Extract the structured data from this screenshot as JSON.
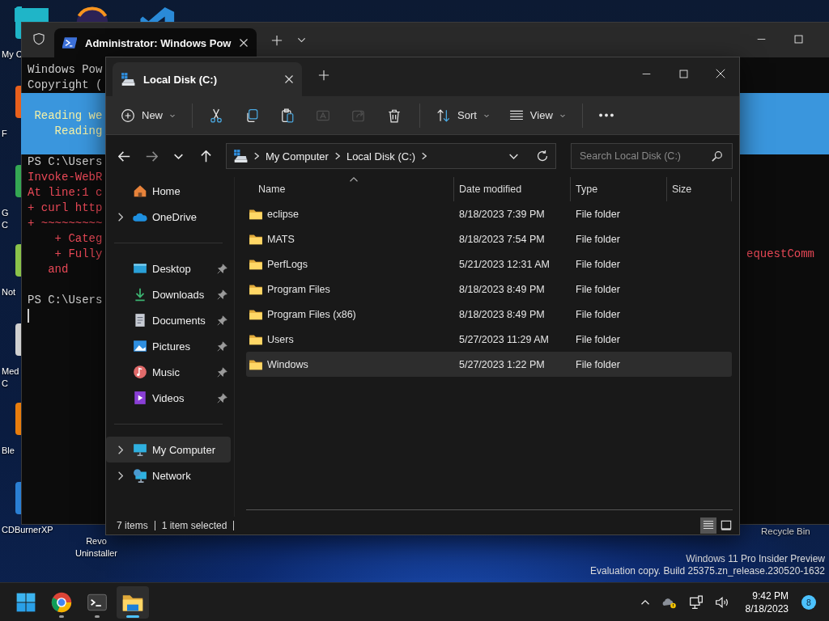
{
  "desktop": {
    "icons": [
      {
        "lines": [
          "My C"
        ],
        "color": "#1fb5c8"
      },
      {
        "lines": [
          "F"
        ],
        "color": "#e8601c"
      },
      {
        "lines": [
          "G",
          "C"
        ],
        "color": "#34a853"
      },
      {
        "lines": [
          "Not"
        ],
        "color": "#8bc34a"
      },
      {
        "lines": [
          "Med",
          "C"
        ],
        "color": "#d0d0d0"
      },
      {
        "lines": [
          "Ble"
        ],
        "color": "#e87d0d"
      },
      {
        "lines": [
          "CDBurnerXP"
        ],
        "color": "#2a7fd4"
      }
    ],
    "uninstaller_label": [
      "Revo",
      "Uninstaller"
    ],
    "recycle_bin_label": "Recycle Bin",
    "watermark": [
      "Windows 11 Pro Insider Preview",
      "Evaluation copy. Build 25375.zn_release.230520-1632"
    ]
  },
  "terminal_window": {
    "tab_title": "Administrator: Windows Pow",
    "lines": [
      {
        "text": "Windows Pow",
        "kind": "normal"
      },
      {
        "text": "Copyright (",
        "kind": "normal"
      },
      {
        "kind": "banner"
      },
      {
        "text": " Reading we",
        "kind": "banner"
      },
      {
        "text": "    Reading",
        "kind": "banner"
      },
      {
        "kind": "banner"
      },
      {
        "text": "PS C:\\Users",
        "kind": "normal"
      },
      {
        "text": "Invoke-WebR",
        "kind": "error"
      },
      {
        "text": "At line:1 c",
        "kind": "error"
      },
      {
        "text": "+ curl http",
        "kind": "error"
      },
      {
        "text": "+ ~~~~~~~~~",
        "kind": "error"
      },
      {
        "text": "    + Categ",
        "kind": "error"
      },
      {
        "text": "    + Fully",
        "kind": "error",
        "tail": "equestComm"
      },
      {
        "text": "   and",
        "kind": "error"
      },
      {
        "kind": "normal"
      },
      {
        "text": "PS C:\\Users",
        "kind": "normal"
      }
    ]
  },
  "explorer_window": {
    "tab_title": "Local Disk (C:)",
    "toolbar": [
      {
        "kind": "new",
        "label": "New",
        "disabled": false
      },
      {
        "kind": "separator"
      },
      {
        "kind": "cut",
        "disabled": false
      },
      {
        "kind": "copy",
        "disabled": false
      },
      {
        "kind": "paste",
        "disabled": false
      },
      {
        "kind": "rename",
        "disabled": true
      },
      {
        "kind": "share",
        "disabled": true
      },
      {
        "kind": "delete",
        "disabled": false
      },
      {
        "kind": "separator"
      },
      {
        "kind": "sort",
        "label": "Sort",
        "disabled": false
      },
      {
        "kind": "view",
        "label": "View",
        "disabled": false
      },
      {
        "kind": "separator"
      },
      {
        "kind": "more",
        "disabled": false
      }
    ],
    "nav_buttons": [
      {
        "kind": "back",
        "disabled": false
      },
      {
        "kind": "forward",
        "disabled": true
      },
      {
        "kind": "recent",
        "disabled": false
      },
      {
        "kind": "up",
        "disabled": false
      }
    ],
    "breadcrumbs": [
      "My Computer",
      "Local Disk (C:)"
    ],
    "search": {
      "placeholder": "Search Local Disk (C:)"
    },
    "sidebar": {
      "sections": [
        [
          {
            "label": "Home",
            "kind": "home",
            "expandable": false,
            "pinned": false,
            "selected": false
          },
          {
            "label": "OneDrive",
            "kind": "onedrive",
            "expandable": true,
            "pinned": false,
            "selected": false
          }
        ],
        [
          {
            "label": "Desktop",
            "kind": "desktop",
            "expandable": false,
            "pinned": true,
            "selected": false
          },
          {
            "label": "Downloads",
            "kind": "downloads",
            "expandable": false,
            "pinned": true,
            "selected": false
          },
          {
            "label": "Documents",
            "kind": "documents",
            "expandable": false,
            "pinned": true,
            "selected": false
          },
          {
            "label": "Pictures",
            "kind": "pictures",
            "expandable": false,
            "pinned": true,
            "selected": false
          },
          {
            "label": "Music",
            "kind": "music",
            "expandable": false,
            "pinned": true,
            "selected": false
          },
          {
            "label": "Videos",
            "kind": "videos",
            "expandable": false,
            "pinned": true,
            "selected": false
          }
        ],
        [
          {
            "label": "My Computer",
            "kind": "computer",
            "expandable": true,
            "pinned": false,
            "selected": true
          },
          {
            "label": "Network",
            "kind": "network",
            "expandable": true,
            "pinned": false,
            "selected": false
          }
        ]
      ]
    },
    "table": {
      "columns": [
        {
          "label": "Name",
          "sorted": true
        },
        {
          "label": "Date modified",
          "sorted": false
        },
        {
          "label": "Type",
          "sorted": false
        },
        {
          "label": "Size",
          "sorted": false
        }
      ],
      "rows": [
        {
          "name": "eclipse",
          "date_modified": "8/18/2023 7:39 PM",
          "type": "File folder",
          "selected": false
        },
        {
          "name": "MATS",
          "date_modified": "8/18/2023 7:54 PM",
          "type": "File folder",
          "selected": false
        },
        {
          "name": "PerfLogs",
          "date_modified": "5/21/2023 12:31 AM",
          "type": "File folder",
          "selected": false
        },
        {
          "name": "Program Files",
          "date_modified": "8/18/2023 8:49 PM",
          "type": "File folder",
          "selected": false
        },
        {
          "name": "Program Files (x86)",
          "date_modified": "8/18/2023 8:49 PM",
          "type": "File folder",
          "selected": false
        },
        {
          "name": "Users",
          "date_modified": "5/27/2023 11:29 AM",
          "type": "File folder",
          "selected": false
        },
        {
          "name": "Windows",
          "date_modified": "5/27/2023 1:22 PM",
          "type": "File folder",
          "selected": true
        }
      ]
    },
    "status_bar": {
      "item_count": "7 items",
      "selection": "1 item selected"
    },
    "view_buttons": [
      {
        "kind": "details",
        "selected": true
      },
      {
        "kind": "tiles",
        "selected": false
      }
    ]
  },
  "taskbar": {
    "apps": [
      {
        "kind": "start",
        "running": false,
        "selected": false
      },
      {
        "kind": "chrome",
        "running": true,
        "selected": false
      },
      {
        "kind": "terminal",
        "running": true,
        "selected": false
      },
      {
        "kind": "explorer",
        "running": true,
        "selected": true
      }
    ],
    "time": "9:42 PM",
    "date": "8/18/2023",
    "notification_count": "8"
  }
}
